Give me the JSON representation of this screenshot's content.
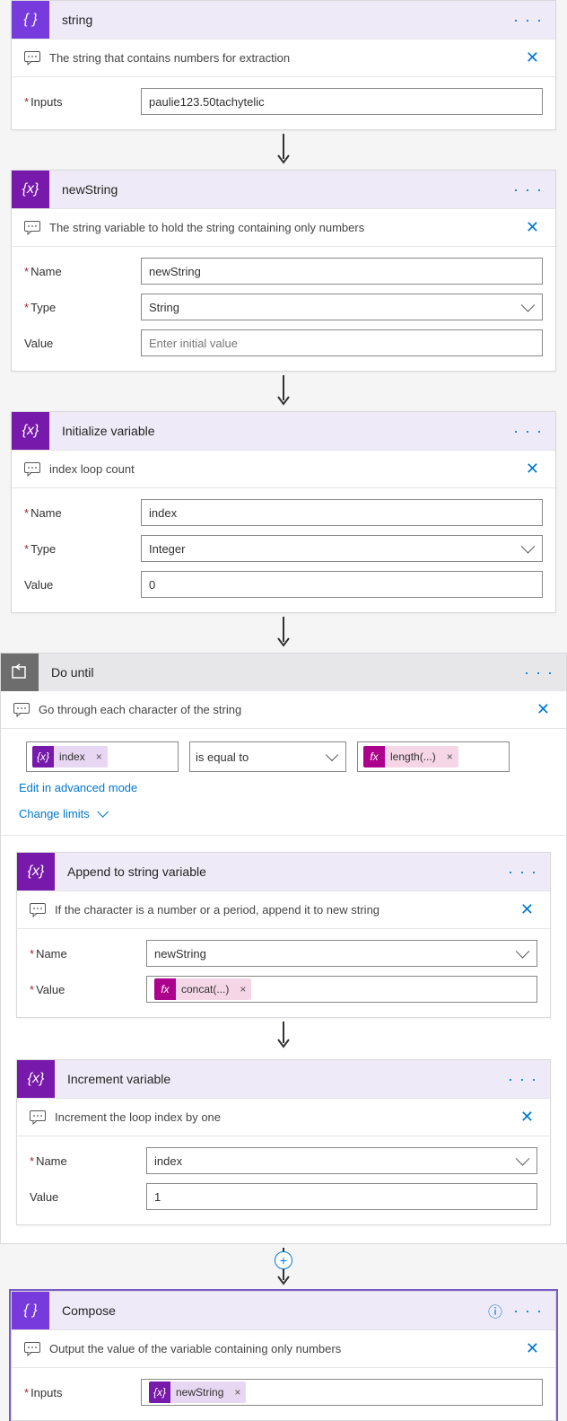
{
  "icons": {
    "brace": "{ }",
    "brace_x": "{x}",
    "fx": "fx",
    "loop": "↺"
  },
  "steps": {
    "string": {
      "title": "string",
      "description": "The string that contains numbers for extraction",
      "fields": {
        "inputs_label": "Inputs",
        "inputs_value": "paulie123.50tachytelic"
      }
    },
    "newString": {
      "title": "newString",
      "description": "The string variable to hold the string containing only numbers",
      "fields": {
        "name_label": "Name",
        "name_value": "newString",
        "type_label": "Type",
        "type_value": "String",
        "value_label": "Value",
        "value_placeholder": "Enter initial value"
      }
    },
    "initIndex": {
      "title": "Initialize variable",
      "description": "index loop count",
      "fields": {
        "name_label": "Name",
        "name_value": "index",
        "type_label": "Type",
        "type_value": "Integer",
        "value_label": "Value",
        "value_value": "0"
      }
    },
    "doUntil": {
      "title": "Do until",
      "description": "Go through each character of the string",
      "condition": {
        "left_token": "index",
        "operator": "is equal to",
        "right_token": "length(...)"
      },
      "links": {
        "advanced": "Edit in advanced mode",
        "limits": "Change limits"
      }
    },
    "append": {
      "title": "Append to string variable",
      "description": "If the character is a number or a period, append it to new string",
      "fields": {
        "name_label": "Name",
        "name_value": "newString",
        "value_label": "Value",
        "value_token": "concat(...)"
      }
    },
    "increment": {
      "title": "Increment variable",
      "description": "Increment the loop index by one",
      "fields": {
        "name_label": "Name",
        "name_value": "index",
        "value_label": "Value",
        "value_value": "1"
      }
    },
    "compose": {
      "title": "Compose",
      "description": "Output the value of the variable containing only numbers",
      "fields": {
        "inputs_label": "Inputs",
        "inputs_token": "newString"
      }
    }
  }
}
